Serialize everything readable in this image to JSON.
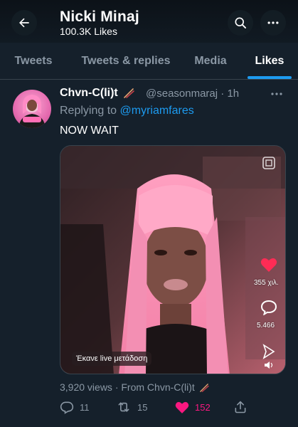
{
  "header": {
    "title": "Nicki Minaj",
    "subtitle": "100.3K Likes",
    "back_icon": "arrow-left-icon",
    "search_icon": "search-icon",
    "more_icon": "more-horizontal-icon"
  },
  "tabs": [
    {
      "label": "Tweets",
      "active": false
    },
    {
      "label": "Tweets & replies",
      "active": false
    },
    {
      "label": "Media",
      "active": false
    },
    {
      "label": "Likes",
      "active": true
    }
  ],
  "tweet": {
    "author_name": "Chvn-C(li)t",
    "handle": "@seasonmaraj",
    "time": "· 1h",
    "replying_prefix": "Replying to",
    "replying_to": "@myriamfares",
    "text": "NOW WAIT",
    "media": {
      "likes_count": "355 χιλ.",
      "comments_count": "5.466",
      "live_label": "Έκανε live μετάδοση"
    },
    "views_line": "3,920 views · From Chvn-C(li)t",
    "replies": "11",
    "retweets": "15",
    "likes": "152",
    "like_color": "#f91880",
    "accent": "#1d9bf0"
  }
}
